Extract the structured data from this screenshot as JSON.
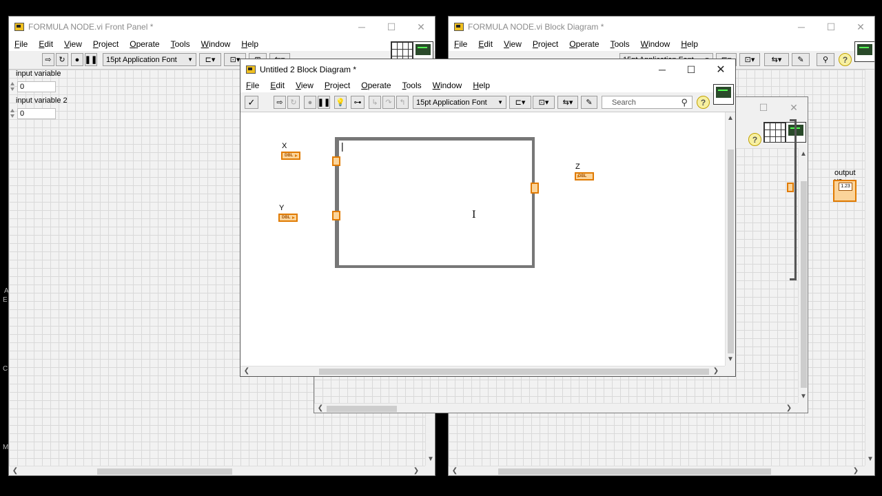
{
  "left_edge_glyphs": [
    "A",
    "E",
    "C",
    "M"
  ],
  "front_panel": {
    "title": "FORMULA NODE.vi Front Panel *",
    "menu": [
      "File",
      "Edit",
      "View",
      "Project",
      "Operate",
      "Tools",
      "Window",
      "Help"
    ],
    "font_label": "15pt Application Font",
    "controls": [
      {
        "label": "input variable",
        "value": "0"
      },
      {
        "label": "input variable 2",
        "value": "0"
      }
    ]
  },
  "main_diagram": {
    "title": "FORMULA NODE.vi Block Diagram *",
    "menu": [
      "File",
      "Edit",
      "View",
      "Project",
      "Operate",
      "Tools",
      "Window",
      "Help"
    ],
    "font_label": "15pt Application Font",
    "output_label": "output va",
    "indicator_text": "1.23"
  },
  "untitled_diagram": {
    "title": "Untitled 2 Block Diagram *",
    "menu": [
      "File",
      "Edit",
      "View",
      "Project",
      "Operate",
      "Tools",
      "Window",
      "Help"
    ],
    "font_label": "15pt Application Font",
    "search_placeholder": "Search",
    "terminals": [
      {
        "label": "X",
        "type_text": "DBL"
      },
      {
        "label": "Y",
        "type_text": "DBL"
      },
      {
        "label": "Z",
        "type_text": "DBL"
      }
    ],
    "node_cursor": "|"
  },
  "icons": {
    "window_minimize": "─",
    "window_maximize": "☐",
    "window_close": "✕",
    "dropdown": "▼",
    "check": "✓",
    "search": "⚲",
    "help": "?",
    "scroll_left": "❮",
    "scroll_right": "❯",
    "scroll_up": "▲",
    "scroll_down": "▼",
    "text_cursor": "I"
  },
  "colors": {
    "terminal_orange": "#e07a00",
    "terminal_fill": "#fbd49a",
    "grid_line": "#d9d9d9",
    "desktop": "#000000"
  }
}
